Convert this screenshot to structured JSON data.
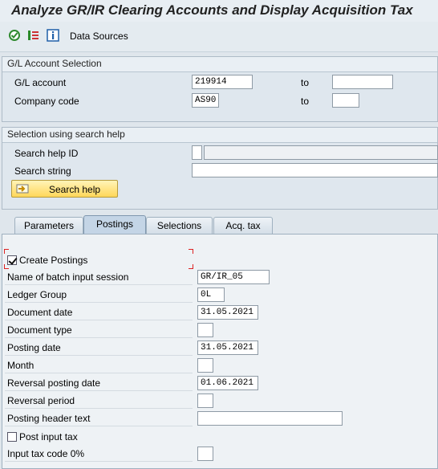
{
  "window": {
    "title": "Analyze GR/IR Clearing Accounts and Display Acquisition Tax"
  },
  "toolbar": {
    "execute_icon": "execute-icon",
    "variant_icon": "variant-list-icon",
    "info_icon": "info-icon",
    "data_sources_label": "Data Sources"
  },
  "gl_selection": {
    "title": "G/L Account Selection",
    "gl_account_label": "G/L account",
    "gl_account_value": "219914",
    "company_code_label": "Company code",
    "company_code_value": "AS90",
    "to_label": "to",
    "gl_account_to": "",
    "company_code_to": ""
  },
  "search_help": {
    "title": "Selection using search help",
    "id_label": "Search help ID",
    "id_value": "",
    "id_desc": "",
    "string_label": "Search string",
    "string_value": "",
    "button_label": "Search help"
  },
  "tabs": [
    {
      "label": "Parameters",
      "active": false
    },
    {
      "label": "Postings",
      "active": true
    },
    {
      "label": "Selections",
      "active": false
    },
    {
      "label": "Acq. tax",
      "active": false
    }
  ],
  "postings": {
    "create_postings_label": "Create Postings",
    "create_postings_checked": true,
    "batch_session_label": "Name of batch input session",
    "batch_session_value": "GR/IR_05",
    "ledger_group_label": "Ledger Group",
    "ledger_group_value": "0L",
    "document_date_label": "Document date",
    "document_date_value": "31.05.2021",
    "document_type_label": "Document type",
    "document_type_value": "",
    "posting_date_label": "Posting date",
    "posting_date_value": "31.05.2021",
    "month_label": "Month",
    "month_value": "",
    "reversal_posting_date_label": "Reversal posting date",
    "reversal_posting_date_value": "01.06.2021",
    "reversal_period_label": "Reversal period",
    "reversal_period_value": "",
    "posting_header_text_label": "Posting header text",
    "posting_header_text_value": "",
    "post_input_tax_label": "Post input tax",
    "post_input_tax_checked": false,
    "input_tax_code_label": "Input tax code 0%",
    "input_tax_code_value": ""
  }
}
